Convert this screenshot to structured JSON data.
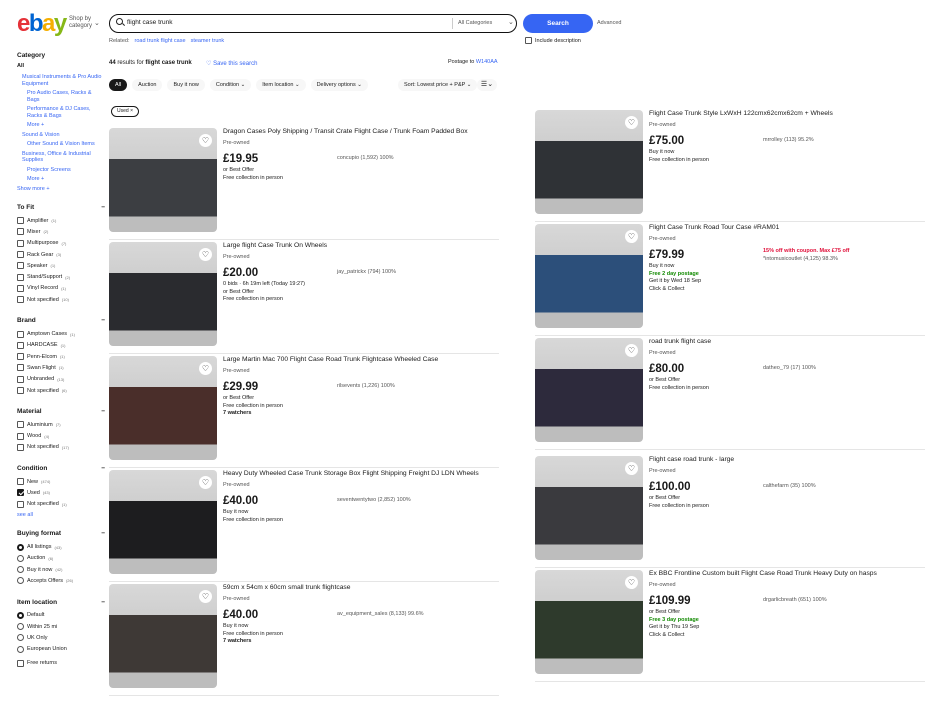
{
  "header": {
    "logo": "ebay",
    "shop_by": "Shop by category",
    "search_query": "flight case trunk",
    "category_select": "All Categories",
    "search_button": "Search",
    "advanced": "Advanced",
    "related_label": "Related:",
    "related": [
      "road trunk flight case",
      "steamer trunk"
    ],
    "include_description": "Include description"
  },
  "sidebar": {
    "category": {
      "title": "Category",
      "all": "All",
      "links": [
        "Musical Instruments & Pro Audio Equipment",
        "Pro Audio Cases, Racks & Bags",
        "Performance & DJ Cases, Racks & Bags",
        "More +",
        "Sound & Vision",
        "Other Sound & Vision Items",
        "Business, Office & Industrial Supplies",
        "Projector Screens",
        "More +",
        "Show more +"
      ]
    },
    "sections": [
      {
        "title": "To Fit",
        "items": [
          [
            "Amplifier",
            "(1)"
          ],
          [
            "Mixer",
            "(2)"
          ],
          [
            "Multipurpose",
            "(7)"
          ],
          [
            "Rack Gear",
            "(3)"
          ],
          [
            "Speaker",
            "(1)"
          ],
          [
            "Stand/Support",
            "(2)"
          ],
          [
            "Vinyl Record",
            "(1)"
          ],
          [
            "Not specified",
            "(10)"
          ]
        ]
      },
      {
        "title": "Brand",
        "items": [
          [
            "Amptown Cases",
            "(1)"
          ],
          [
            "HARDCASE",
            "(1)"
          ],
          [
            "Penn-Elcom",
            "(1)"
          ],
          [
            "Swan Flight",
            "(1)"
          ],
          [
            "Unbranded",
            "(13)"
          ],
          [
            "Not specified",
            "(6)"
          ]
        ]
      },
      {
        "title": "Material",
        "items": [
          [
            "Aluminium",
            "(7)"
          ],
          [
            "Wood",
            "(4)"
          ],
          [
            "Not specified",
            "(17)"
          ]
        ]
      },
      {
        "title": "Condition",
        "items": [
          [
            "New",
            "(474)"
          ],
          [
            "Used",
            "(43)"
          ],
          [
            "Not specified",
            "(1)"
          ]
        ],
        "see_all": "see all"
      },
      {
        "title": "Buying format",
        "items": [
          [
            "All listings",
            "(43)"
          ],
          [
            "Auction",
            "(6)"
          ],
          [
            "Buy it now",
            "(42)"
          ],
          [
            "Accepts Offers",
            "(26)"
          ]
        ]
      },
      {
        "title": "Item location",
        "items": [
          [
            "Default",
            ""
          ],
          [
            "Within 25 mi",
            ""
          ],
          [
            "UK Only",
            ""
          ],
          [
            "European Union",
            ""
          ]
        ],
        "extra": "Free returns"
      }
    ]
  },
  "results": {
    "count": "44",
    "label": "results for",
    "query": "flight case trunk",
    "save": "Save this search",
    "postage_to": "Postage to",
    "postcode": "W140AA"
  },
  "filters": {
    "chips": [
      "All",
      "Auction",
      "Buy it now"
    ],
    "dropdowns": [
      "Condition",
      "Item location",
      "Delivery options"
    ],
    "sort": "Sort: Lowest price + P&P",
    "active": "Used"
  },
  "items": [
    {
      "title": "Dragon Cases Poly Shipping / Transit Crate Flight Case / Trunk Foam Padded Box",
      "condition": "Pre-owned",
      "price": "£19.95",
      "seller": "concupio (1,592) 100%",
      "lines": [
        "or Best Offer",
        "Free collection in person"
      ]
    },
    {
      "title": "Large flight Case Trunk On Wheels",
      "condition": "Pre-owned",
      "price": "£20.00",
      "seller": "jay_patrickx (794) 100%",
      "lines": [
        "0 bids · 6h 19m left (Today 19:27)",
        "or Best Offer",
        "Free collection in person"
      ]
    },
    {
      "title": "Large Martin Mac 700 Flight Case Road Trunk Flightcase Wheeled Case",
      "condition": "Pre-owned",
      "price": "£29.99",
      "seller": "rilsevents (1,226) 100%",
      "lines": [
        "or Best Offer",
        "Free collection in person",
        "7 watchers"
      ]
    },
    {
      "title": "Heavy Duty Wheeled Case Trunk Storage Box Flight Shipping Freight DJ LDN Wheels",
      "condition": "Pre-owned",
      "price": "£40.00",
      "seller": "seventwentytwo (2,852) 100%",
      "lines": [
        "Buy it now",
        "Free collection in person"
      ]
    },
    {
      "title": "59cm x 54cm x 60cm small trunk flightcase",
      "condition": "Pre-owned",
      "price": "£40.00",
      "seller": "av_equipment_sales (8,133) 99.6%",
      "lines": [
        "Buy it now",
        "Free collection in person",
        "7 watchers"
      ]
    },
    {
      "title": "Flight Case Trunk Style LxWxH 122cmx62cmx62cm + Wheels",
      "condition": "Pre-owned",
      "price": "£75.00",
      "seller": "mrrolley (113) 95.2%",
      "lines": [
        "Buy it now",
        "Free collection in person"
      ]
    },
    {
      "title": "Flight Case Trunk Road Tour Case #RAM01",
      "condition": "Pre-owned",
      "price": "£79.99",
      "promo": "15% off with coupon. Max £75 off",
      "seller": "*intomusicoutlet (4,125) 98.3%",
      "lines": [
        "Buy it now",
        "Free 2 day postage",
        "Get it by Wed 18 Sep",
        "Click & Collect"
      ]
    },
    {
      "title": "road trunk flight case",
      "condition": "Pre-owned",
      "price": "£80.00",
      "seller": "datheo_79 (17) 100%",
      "lines": [
        "or Best Offer",
        "Free collection in person"
      ]
    },
    {
      "title": "Flight case road trunk - large",
      "condition": "Pre-owned",
      "price": "£100.00",
      "seller": "calthefarm (35) 100%",
      "lines": [
        "or Best Offer",
        "Free collection in person"
      ]
    },
    {
      "title": "Ex BBC Frontline Custom built Flight Case Road Trunk Heavy Duty on hasps",
      "condition": "Pre-owned",
      "price": "£109.99",
      "seller": "drgarlicbreath (651) 100%",
      "lines": [
        "or Best Offer",
        "Free 3 day postage",
        "Get it by Thu 19 Sep",
        "Click & Collect"
      ]
    }
  ],
  "colors": {
    "link": "#3665f3",
    "button": "#3665f3",
    "green": "#118a00",
    "promo": "#e0103a"
  }
}
